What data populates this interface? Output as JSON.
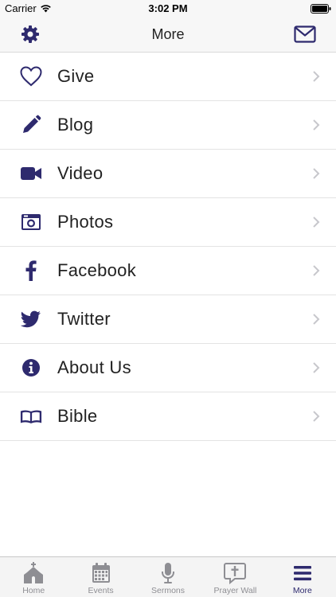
{
  "status_bar": {
    "carrier": "Carrier",
    "time": "3:02 PM"
  },
  "nav": {
    "title": "More",
    "left_icon": "gear-icon",
    "right_icon": "envelope-icon"
  },
  "colors": {
    "accent": "#2e2a6e",
    "inactive": "#8e8e93",
    "chevron": "#c7c7cc"
  },
  "menu": {
    "items": [
      {
        "label": "Give",
        "icon": "heart-icon"
      },
      {
        "label": "Blog",
        "icon": "pencil-icon"
      },
      {
        "label": "Video",
        "icon": "video-camera-icon"
      },
      {
        "label": "Photos",
        "icon": "camera-icon"
      },
      {
        "label": "Facebook",
        "icon": "facebook-icon"
      },
      {
        "label": "Twitter",
        "icon": "twitter-icon"
      },
      {
        "label": "About Us",
        "icon": "info-icon"
      },
      {
        "label": "Bible",
        "icon": "book-icon"
      }
    ]
  },
  "tabs": {
    "items": [
      {
        "label": "Home",
        "icon": "church-icon"
      },
      {
        "label": "Events",
        "icon": "calendar-icon"
      },
      {
        "label": "Sermons",
        "icon": "microphone-icon"
      },
      {
        "label": "Prayer Wall",
        "icon": "prayer-bubble-icon"
      },
      {
        "label": "More",
        "icon": "hamburger-menu-icon",
        "selected": true
      }
    ]
  }
}
